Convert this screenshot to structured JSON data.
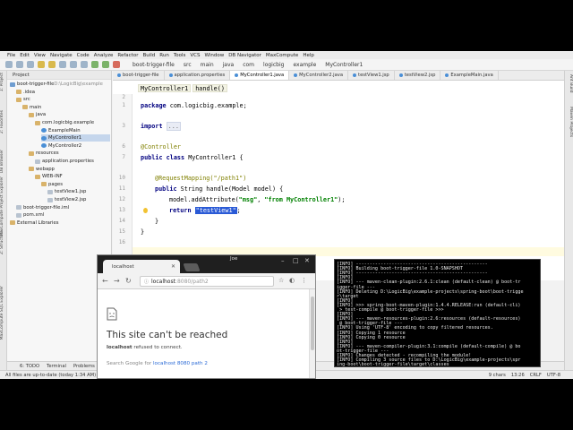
{
  "menu": [
    "File",
    "Edit",
    "View",
    "Navigate",
    "Code",
    "Analyze",
    "Refactor",
    "Build",
    "Run",
    "Tools",
    "VCS",
    "Window",
    "DB Navigator",
    "MaxCompute",
    "Help"
  ],
  "toolbar": {
    "crumbs": [
      "boot-trigger-file",
      "src",
      "main",
      "java",
      "com",
      "logicbig",
      "example",
      "MyController1"
    ]
  },
  "left_strip": [
    "1: Project",
    "2: Favorites",
    "DB Browser",
    "MaxCompute Project Explorer",
    "Z: Structure",
    "MaxCompute SQL Explorer"
  ],
  "right_strip": [
    "Ant Build",
    "Maven Projects"
  ],
  "project": {
    "header": "Project",
    "tree": [
      {
        "label": "boot-trigger-file",
        "suffix": " D:\\LogicBig\\example",
        "icon": "module",
        "indent": 0
      },
      {
        "label": ".idea",
        "icon": "folder",
        "indent": 1
      },
      {
        "label": "src",
        "icon": "folder",
        "indent": 1
      },
      {
        "label": "main",
        "icon": "folder",
        "indent": 2
      },
      {
        "label": "java",
        "icon": "folder",
        "indent": 3
      },
      {
        "label": "com.logicbig.example",
        "icon": "folder",
        "indent": 4
      },
      {
        "label": "ExampleMain",
        "icon": "cls",
        "indent": 5
      },
      {
        "label": "MyController1",
        "icon": "cls",
        "indent": 5,
        "selected": true
      },
      {
        "label": "MyController2",
        "icon": "cls",
        "indent": 5
      },
      {
        "label": "resources",
        "icon": "folder",
        "indent": 3
      },
      {
        "label": "application.properties",
        "icon": "file",
        "indent": 4
      },
      {
        "label": "webapp",
        "icon": "folder",
        "indent": 3
      },
      {
        "label": "WEB-INF",
        "icon": "folder",
        "indent": 4
      },
      {
        "label": "pages",
        "icon": "folder",
        "indent": 5
      },
      {
        "label": "testView1.jsp",
        "icon": "file",
        "indent": 6
      },
      {
        "label": "testView2.jsp",
        "icon": "file",
        "indent": 6
      },
      {
        "label": "boot-trigger-file.iml",
        "icon": "file",
        "indent": 1
      },
      {
        "label": "pom.xml",
        "icon": "file",
        "indent": 1
      },
      {
        "label": "External Libraries",
        "icon": "folder",
        "indent": 0
      }
    ]
  },
  "tabs": [
    {
      "label": "boot-trigger-file",
      "active": false
    },
    {
      "label": "application.properties",
      "active": false
    },
    {
      "label": "MyController1.java",
      "active": true
    },
    {
      "label": "MyController2.java",
      "active": false
    },
    {
      "label": "testView1.jsp",
      "active": false
    },
    {
      "label": "testView2.jsp",
      "active": false
    },
    {
      "label": "ExampleMain.java",
      "active": false
    }
  ],
  "editor": {
    "crumb_class": "MyController1",
    "crumb_method": "handle()",
    "line_numbers": [
      "1",
      "2",
      "3",
      "",
      "",
      "6",
      "7",
      "",
      "",
      "10",
      "11",
      "12",
      "13",
      "14",
      "15",
      "16"
    ],
    "code": {
      "l1_kw": "package",
      "l1_rest": " com.logicbig.example;",
      "l3_kw": "import",
      "l3_fold": "...",
      "l6": "@Controller",
      "l7_kw": "public class",
      "l7_rest": " MyController1 {",
      "l10": "@RequestMapping(\"/path1\")",
      "l11_kw": "public",
      "l11_rest": " String handle(Model model) {",
      "l12_pre": "model.addAttribute(",
      "l12_s1": "\"msg\"",
      "l12_mid": ", ",
      "l12_s2": "\"from MyController1\"",
      "l12_post": ");",
      "l13_kw": "return",
      "l13_str": "\"testView1\"",
      "l13_post": ";",
      "l14": "}",
      "l15": "}"
    }
  },
  "bottom_tabs": [
    "6: TODO",
    "Terminal",
    "Problems"
  ],
  "status": {
    "left": "All files are up-to-date (today 1:34 AM)",
    "right": [
      "9 chars",
      "13:26",
      "CRLF",
      "UTF-8"
    ]
  },
  "browser": {
    "tab_title": "localhost",
    "user": "Joe",
    "url_host": "localhost",
    "url_rest": ":8080/path2",
    "error_title": "This site can't be reached",
    "error_host": "localhost",
    "error_msg": " refused to connect.",
    "try_text": "Search Google for",
    "try_link": "localhost 8080 path 2"
  },
  "terminal": {
    "lines": [
      "[INFO] ------------------------------------------------",
      "[INFO] Building boot-trigger-file 1.0-SNAPSHOT",
      "[INFO] ------------------------------------------------",
      "[INFO]",
      "[INFO] --- maven-clean-plugin:2.6.1:clean (default-clean) @ boot-tr",
      "igger-file ---",
      "[INFO] Deleting D:\\LogicBig\\example-projects\\spring-boot\\boot-trigge",
      "r\\target",
      "[INFO]",
      "[INFO] >>> spring-boot-maven-plugin:1.4.4.RELEASE:run (default-cli)",
      " > test-compile @ boot-trigger-file >>>",
      "[INFO]",
      "[INFO] --- maven-resources-plugin:2.6:resources (default-resources)",
      " @ boot-trigger-file ---",
      "[INFO] Using 'UTF-8' encoding to copy filtered resources.",
      "[INFO] Copying 1 resource",
      "[INFO] Copying 0 resource",
      "[INFO]",
      "[INFO] --- maven-compiler-plugin:3.1:compile (default-compile) @ bo",
      "ot-trigger-file ---",
      "[INFO] Changes detected - recompiling the module!",
      "[INFO] Compiling 3 source files to D:\\LogicBig\\example-projects\\spr",
      "ing-boot\\boot-trigger-file\\target\\classes"
    ]
  }
}
